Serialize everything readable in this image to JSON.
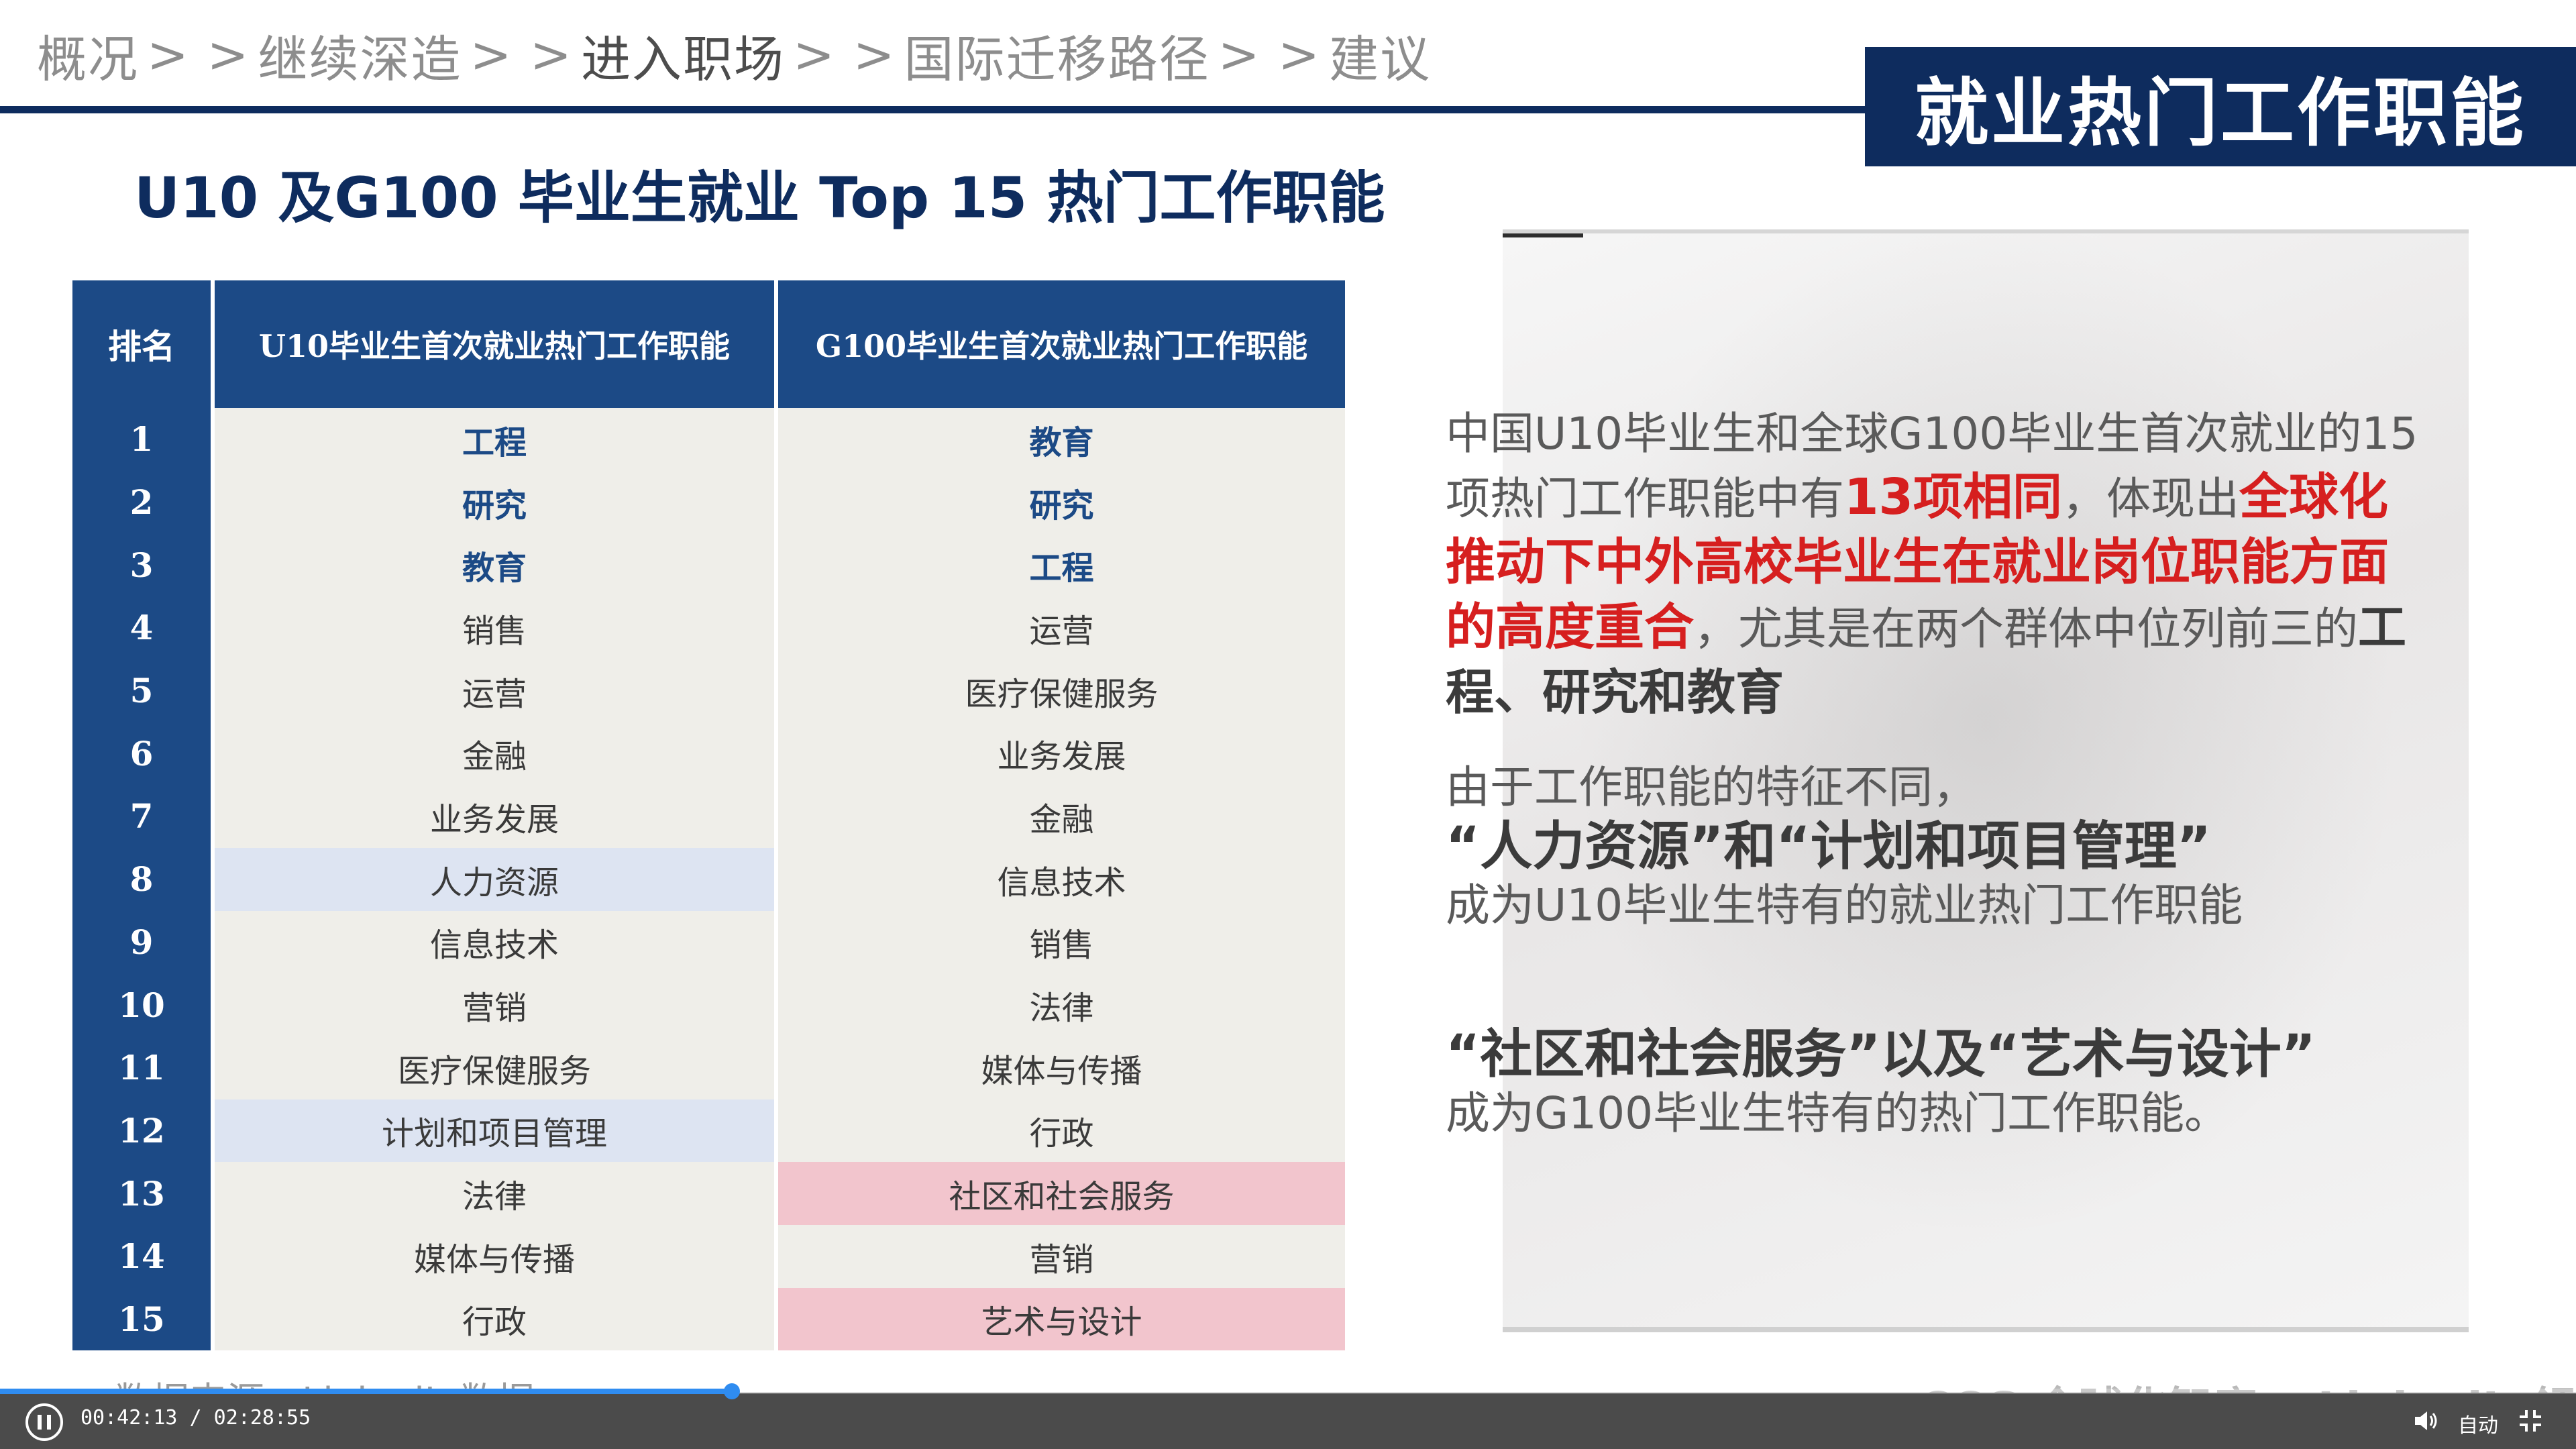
{
  "breadcrumb": [
    {
      "label": "概况",
      "active": false
    },
    {
      "label": "继续深造",
      "active": false
    },
    {
      "label": "进入职场",
      "active": true
    },
    {
      "label": "国际迁移路径",
      "active": false
    },
    {
      "label": "建议",
      "active": false
    }
  ],
  "breadcrumb_separator": "> >",
  "title": "就业热门工作职能",
  "subtitle": "U10 及G100 毕业生就业 Top 15 热门工作职能",
  "table": {
    "headers": [
      "排名",
      "U10毕业生首次就业热门工作职能",
      "G100毕业生首次就业热门工作职能"
    ],
    "rows": [
      {
        "rank": "1",
        "u10": "工程",
        "g100": "教育"
      },
      {
        "rank": "2",
        "u10": "研究",
        "g100": "研究"
      },
      {
        "rank": "3",
        "u10": "教育",
        "g100": "工程"
      },
      {
        "rank": "4",
        "u10": "销售",
        "g100": "运营"
      },
      {
        "rank": "5",
        "u10": "运营",
        "g100": "医疗保健服务"
      },
      {
        "rank": "6",
        "u10": "金融",
        "g100": "业务发展"
      },
      {
        "rank": "7",
        "u10": "业务发展",
        "g100": "金融"
      },
      {
        "rank": "8",
        "u10": "人力资源",
        "g100": "信息技术"
      },
      {
        "rank": "9",
        "u10": "信息技术",
        "g100": "销售"
      },
      {
        "rank": "10",
        "u10": "营销",
        "g100": "法律"
      },
      {
        "rank": "11",
        "u10": "医疗保健服务",
        "g100": "媒体与传播"
      },
      {
        "rank": "12",
        "u10": "计划和项目管理",
        "g100": "行政"
      },
      {
        "rank": "13",
        "u10": "法律",
        "g100": "社区和社会服务"
      },
      {
        "rank": "14",
        "u10": "媒体与传播",
        "g100": "营销"
      },
      {
        "rank": "15",
        "u10": "行政",
        "g100": "艺术与设计"
      }
    ],
    "highlight_u10_rows": [
      "8",
      "12"
    ],
    "highlight_g100_rows": [
      "13",
      "15"
    ],
    "colors": {
      "header": "#1c4a86",
      "cell": "#efeee9",
      "u10_highlight": "#dde4f2",
      "g100_highlight": "#f2c5cd"
    }
  },
  "commentary": {
    "p1_a": "中国U10毕业生和全球G100毕业生首次就业的15项热门工作职能中有",
    "p1_red1": "13项相同",
    "p1_b": "，体现出",
    "p1_red2": "全球化推动下中外高校毕业生在就业岗位职能方面的高度重合",
    "p1_c": "，尤其是在两个群体中位列前三的",
    "p1_bold": "工程、研究和教育",
    "p2_line1": "由于工作职能的特征不同，",
    "p2_line2": "“人力资源”和“计划和项目管理”",
    "p2_line3": "成为U10毕业生特有的就业热门工作职能",
    "p3_line1": "“社区和社会服务”以及“艺术与设计”",
    "p3_line2": "成为G100毕业生特有的热门工作职能。"
  },
  "source": "数据来源：LinkedIn数据",
  "logos": "CCG 全球化智库 ▪ LinkedIn领英",
  "player": {
    "time": "00:42:13 / 02:28:55",
    "progress": 0.284,
    "auto_label": "自动"
  }
}
